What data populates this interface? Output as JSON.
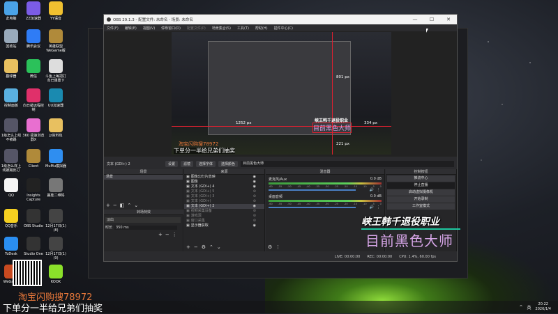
{
  "desktop_icons": [
    {
      "label": "此电脑",
      "color": "#4aa3e8"
    },
    {
      "label": "ZZ加速器",
      "color": "#7b5ce6"
    },
    {
      "label": "YY语音",
      "color": "#f0c030"
    },
    {
      "label": "回收站",
      "color": "#9ab"
    },
    {
      "label": "腾讯会议",
      "color": "#2f7cf6"
    },
    {
      "label": "英雄联盟WeGame版",
      "color": "#b08a3a"
    },
    {
      "label": "翻译器",
      "color": "#e8c060"
    },
    {
      "label": "微信",
      "color": "#2bc15a"
    },
    {
      "label": "斗鱼上每把打向已爆重下",
      "color": "#ddd"
    },
    {
      "label": "控制面板",
      "color": "#5ab0e0"
    },
    {
      "label": "向日葵远程控制",
      "color": "#e0306a"
    },
    {
      "label": "UU加速器",
      "color": "#1a8ab0"
    },
    {
      "label": "1级怎么上线不被踢",
      "color": "#556"
    },
    {
      "label": "360 极速浏览器X",
      "color": "#e86fd0"
    },
    {
      "label": "Jz资料包",
      "color": "#e8c060"
    },
    {
      "label": "1级怎么样上线被踢反打",
      "color": "#556"
    },
    {
      "label": "Client",
      "color": "#b08a3a"
    },
    {
      "label": "MuMu模拟器",
      "color": "#2f8ef0"
    },
    {
      "label": "QQ",
      "color": "#f5f5f5"
    },
    {
      "label": "Insights Capture",
      "color": "#222"
    },
    {
      "label": "赢桂二维码",
      "color": "#777"
    },
    {
      "label": "QQ音乐",
      "color": "#f5d020"
    },
    {
      "label": "OBS Studio",
      "color": "#333"
    },
    {
      "label": "12月17日(1)(8)",
      "color": "#444"
    },
    {
      "label": "ToDesk",
      "color": "#2a8ef0"
    },
    {
      "label": "Studio One",
      "color": "#333"
    },
    {
      "label": "12月17日(1)(9)",
      "color": "#444"
    },
    {
      "label": "WeGame",
      "color": "#c84a20"
    },
    {
      "label": "",
      "color": "#fff"
    },
    {
      "label": "KOOK",
      "color": "#8be02a"
    }
  ],
  "obs": {
    "title": "OBS 29.1.3 - 配置文件: 未命名 - 场景: 未命名",
    "window_controls": [
      "—",
      "☐",
      "✕"
    ],
    "menu": [
      "文件(F)",
      "编辑(E)",
      "视图(V)",
      "停靠窗口(D)",
      "配置文件(P)",
      "场景集合(S)",
      "工具(T)",
      "帮助(H)",
      "插件中心(C)"
    ],
    "preview": {
      "guide_top": "801 px",
      "guide_left": "1252 px",
      "guide_right": "334 px",
      "guide_bottom": "221 px",
      "selected_text": "目前黑色大师",
      "title_text": "峡王韩千退役职业",
      "promo_text": "淘宝闪购搜78972",
      "promo_text2": "下单分一半给兄弟们抽奖"
    },
    "toolbar": {
      "source": "文本 (GDI+) 2",
      "settings": "设置",
      "filters": "滤镜",
      "select_font": "选择字体",
      "select_color": "选择颜色",
      "text_value": "目前黑色大师"
    },
    "scenes": {
      "header": "场景",
      "items": [
        "场景"
      ]
    },
    "transitions": {
      "header": "转场特效",
      "type": "淡出",
      "duration_label": "时长",
      "duration": "350 ms"
    },
    "sources": {
      "header": "来源",
      "items": [
        {
          "name": "图像幻灯片放映",
          "visible": true
        },
        {
          "name": "图像",
          "visible": true
        },
        {
          "name": "文本 (GDI+) 4",
          "visible": true
        },
        {
          "name": "文本 (GDI+) 5",
          "visible": false
        },
        {
          "name": "文本 (GDI+) 3",
          "visible": false
        },
        {
          "name": "文本 (GDI+)",
          "visible": false
        },
        {
          "name": "文本 (GDI+) 2",
          "visible": true,
          "selected": true
        },
        {
          "name": "视频采集设备",
          "visible": false
        },
        {
          "name": "游戏源",
          "visible": false
        },
        {
          "name": "窗口采集",
          "visible": false
        },
        {
          "name": "显示器获取",
          "visible": true
        }
      ]
    },
    "mixer": {
      "header": "混音器",
      "ticks": [
        "-60",
        "-55",
        "-50",
        "-45",
        "-40",
        "-35",
        "-30",
        "-25",
        "-20",
        "-15",
        "-10",
        "-5",
        "0"
      ],
      "channels": [
        {
          "name": "麦克风/Aux",
          "db": "0.0 dB",
          "volume": 0.9
        },
        {
          "name": "桌面音频",
          "db": "0.0 dB",
          "volume": 0.9
        }
      ]
    },
    "controls": {
      "header": "控制按钮",
      "buttons": [
        "推流中心",
        "停止直播",
        "启动虚拟摄像机",
        "开始录制",
        "工作室模式"
      ]
    },
    "status": {
      "live": "LIVE: 00:00:00",
      "rec": "REC: 00:00:00",
      "cpu": "CPU: 1.4%, 60.00 fps"
    }
  },
  "overlay": {
    "title": "峡王韩千退役职业",
    "subtitle": "目前黑色大师",
    "promo": "淘宝闪购搜78972",
    "promo2": "下单分一半给兄弟们抽奖"
  },
  "tray": {
    "chevron": "^",
    "ime": "英",
    "time": "20:22",
    "date": "2026/1/4"
  }
}
